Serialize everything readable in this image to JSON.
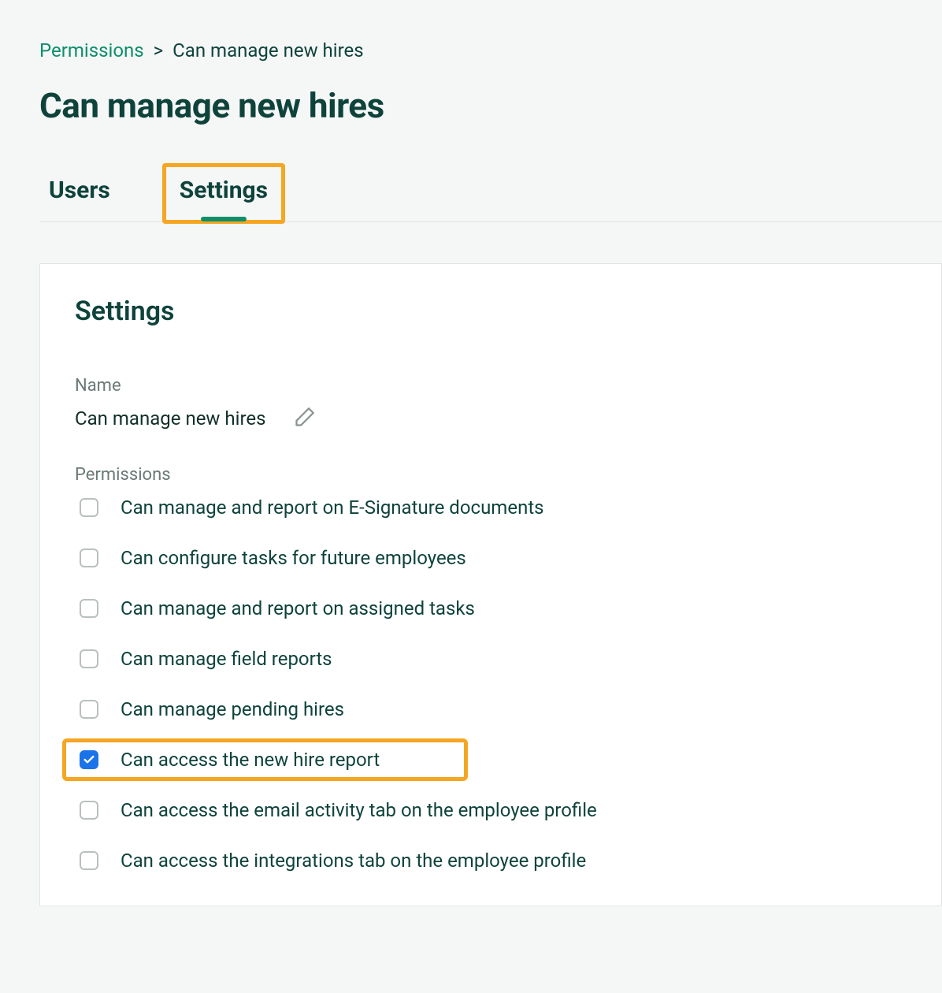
{
  "breadcrumb": {
    "root": "Permissions",
    "sep": ">",
    "current": "Can manage new hires"
  },
  "page_title": "Can manage new hires",
  "tabs": [
    {
      "label": "Users",
      "active": false,
      "highlight": false
    },
    {
      "label": "Settings",
      "active": true,
      "highlight": true
    }
  ],
  "settings": {
    "heading": "Settings",
    "name_label": "Name",
    "name_value": "Can manage new hires",
    "permissions_label": "Permissions",
    "permissions": [
      {
        "label": "Can manage and report on E-Signature documents",
        "checked": false,
        "highlight": false
      },
      {
        "label": "Can configure tasks for future employees",
        "checked": false,
        "highlight": false
      },
      {
        "label": "Can manage and report on assigned tasks",
        "checked": false,
        "highlight": false
      },
      {
        "label": "Can manage field reports",
        "checked": false,
        "highlight": false
      },
      {
        "label": "Can manage pending hires",
        "checked": false,
        "highlight": false
      },
      {
        "label": "Can access the new hire report",
        "checked": true,
        "highlight": true
      },
      {
        "label": "Can access the email activity tab on the employee profile",
        "checked": false,
        "highlight": false
      },
      {
        "label": "Can access the integrations tab on the employee profile",
        "checked": false,
        "highlight": false
      }
    ]
  },
  "colors": {
    "accent": "#0d8f6a",
    "highlight_border": "#f5a623",
    "checked_bg": "#1a73e8"
  }
}
